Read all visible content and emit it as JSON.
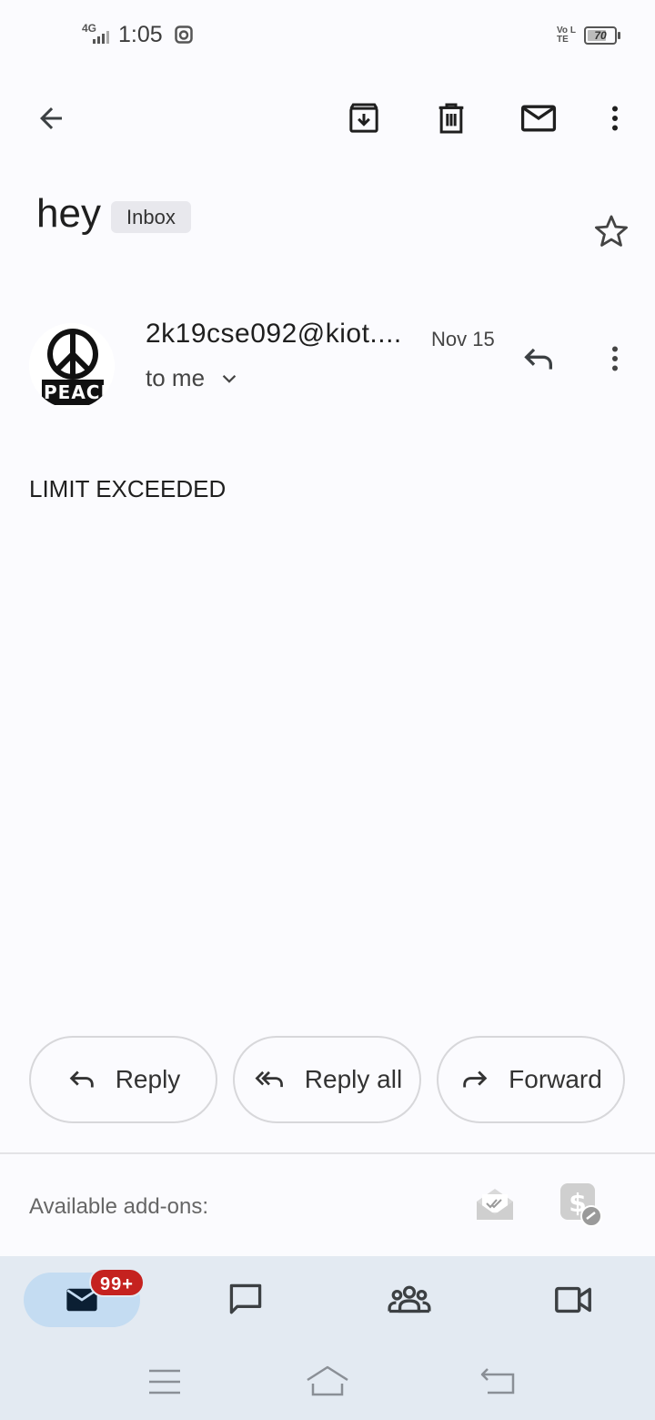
{
  "status_bar": {
    "network": "4G",
    "time": "1:05",
    "volte": "Vo LTE",
    "battery": "70",
    "battery_level": 0.7
  },
  "toolbar": {
    "back_icon": "arrow-left-icon",
    "archive_icon": "archive-icon",
    "delete_icon": "trash-icon",
    "mark_unread_icon": "mail-icon",
    "more_icon": "more-vert-icon"
  },
  "email": {
    "subject": "hey",
    "label": "Inbox",
    "sender": "2k19cse092@kiot....",
    "date": "Nov 15",
    "recipient": "to me",
    "avatar_text": "PEACE",
    "body": "LIMIT EXCEEDED"
  },
  "actions": {
    "reply": "Reply",
    "reply_all": "Reply all",
    "forward": "Forward"
  },
  "addons": {
    "label": "Available add-ons:"
  },
  "bottom_nav": {
    "mail_badge": "99+",
    "items": [
      "mail-icon",
      "chat-icon",
      "spaces-icon",
      "meet-icon"
    ]
  },
  "colors": {
    "background": "#fbfbfe",
    "nav_background": "#e3eaf2",
    "active_pill": "#c4dcf2",
    "badge": "#c5221f"
  }
}
